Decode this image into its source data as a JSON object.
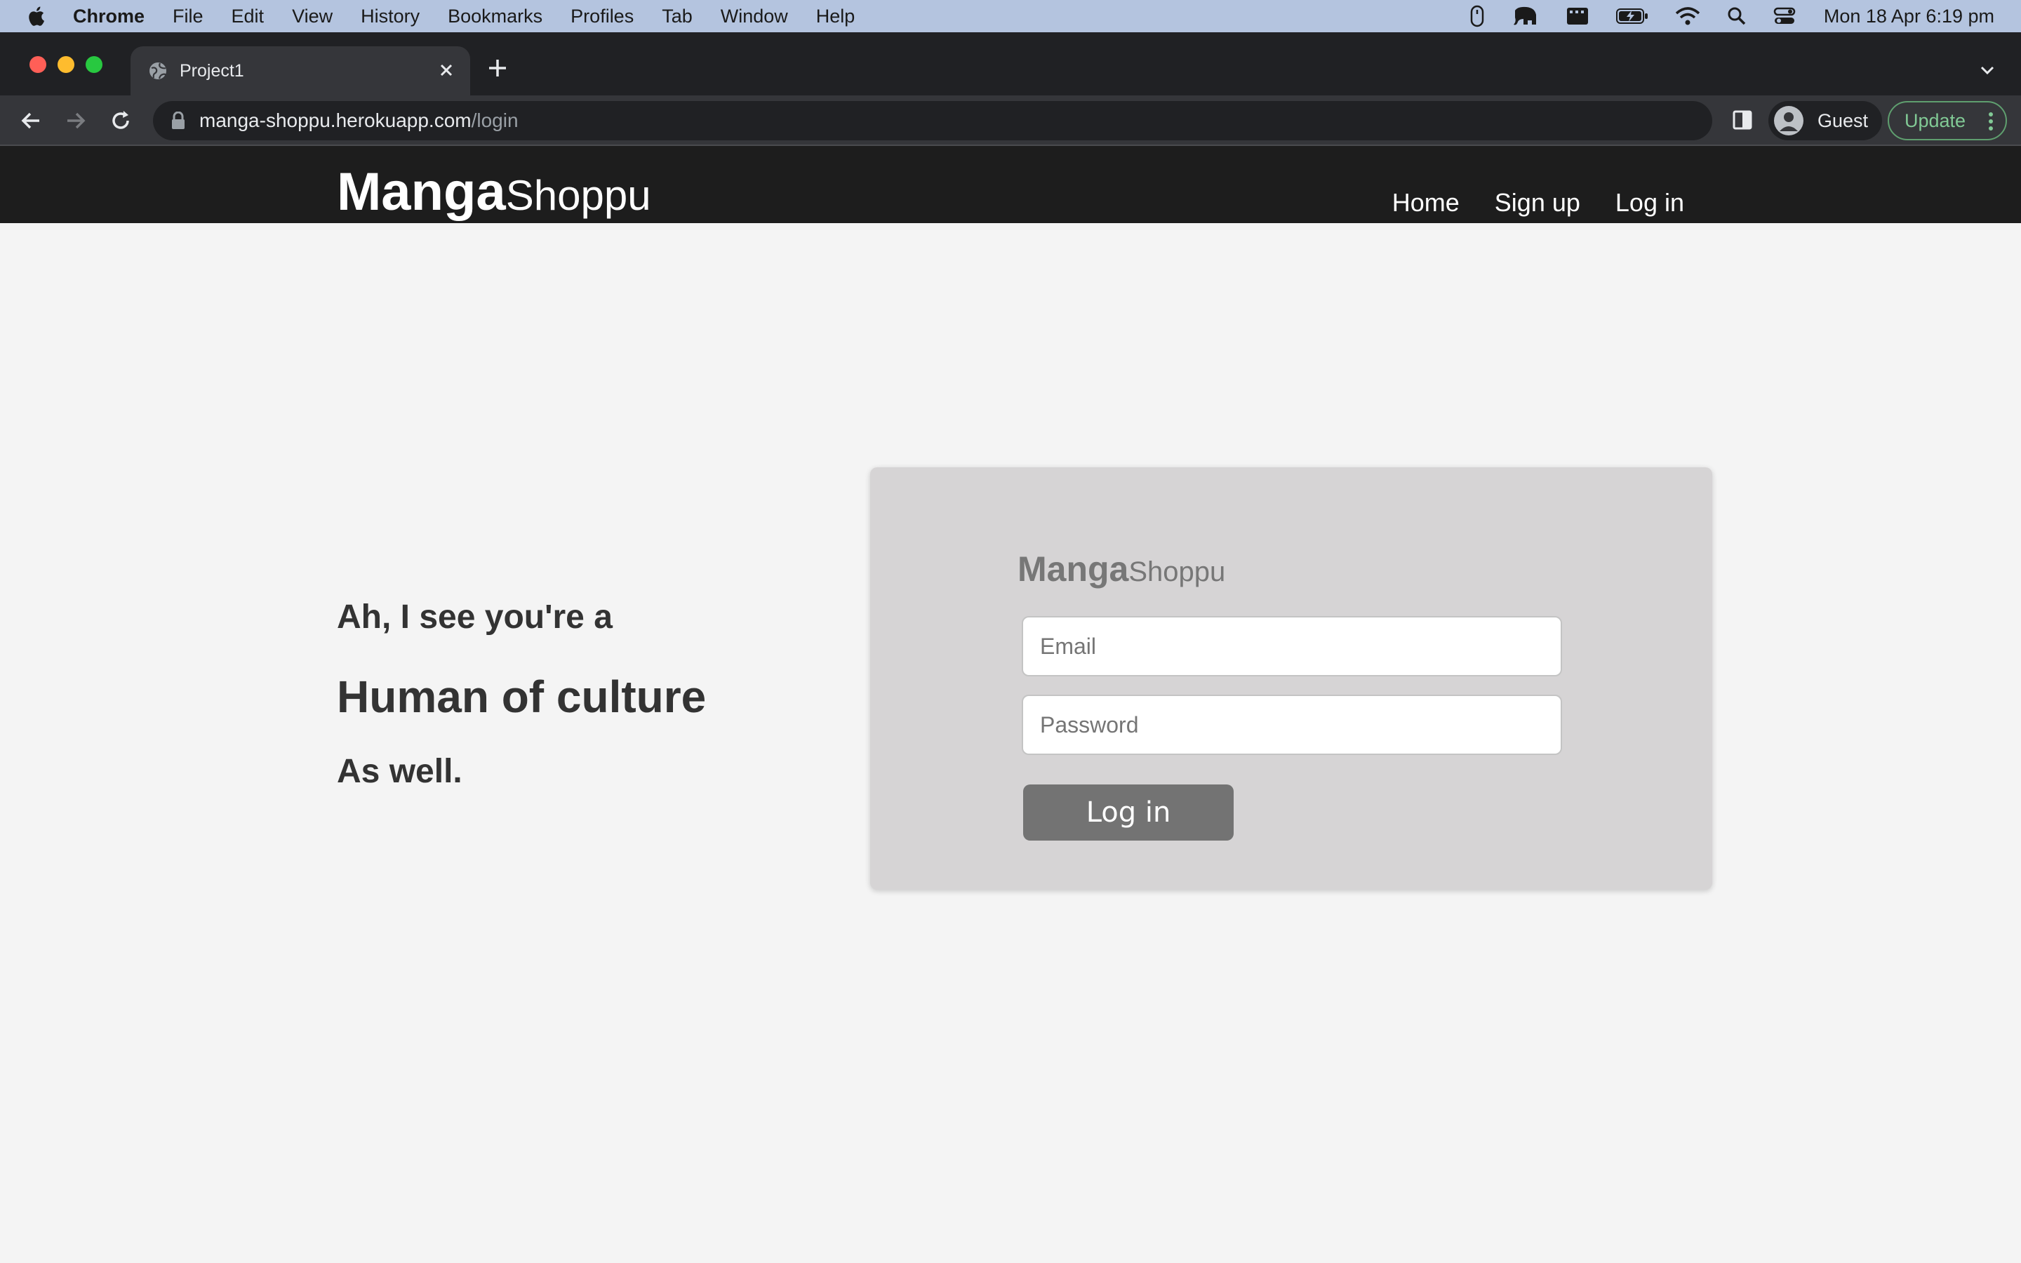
{
  "menubar": {
    "app": "Chrome",
    "items": [
      "File",
      "Edit",
      "View",
      "History",
      "Bookmarks",
      "Profiles",
      "Tab",
      "Window",
      "Help"
    ],
    "clock": "Mon 18 Apr  6:19 pm"
  },
  "browser": {
    "tab_title": "Project1",
    "url_host": "manga-shoppu.herokuapp.com",
    "url_path": "/login",
    "profile_label": "Guest",
    "update_label": "Update"
  },
  "site": {
    "brand_bold": "Manga",
    "brand_light": "Shoppu",
    "nav": [
      "Home",
      "Sign up",
      "Log in"
    ]
  },
  "hero": {
    "line1": "Ah, I see you're a",
    "line2": "Human of culture",
    "line3": "As well."
  },
  "login_form": {
    "brand_bold": "Manga",
    "brand_light": "Shoppu",
    "email_placeholder": "Email",
    "password_placeholder": "Password",
    "submit_label": "Log in"
  },
  "colors": {
    "menubar": "#b4c4df",
    "site_header": "#1d1d1d",
    "page_bg": "#f4f4f4",
    "card_bg": "#d6d4d5",
    "button_bg": "#737373"
  }
}
